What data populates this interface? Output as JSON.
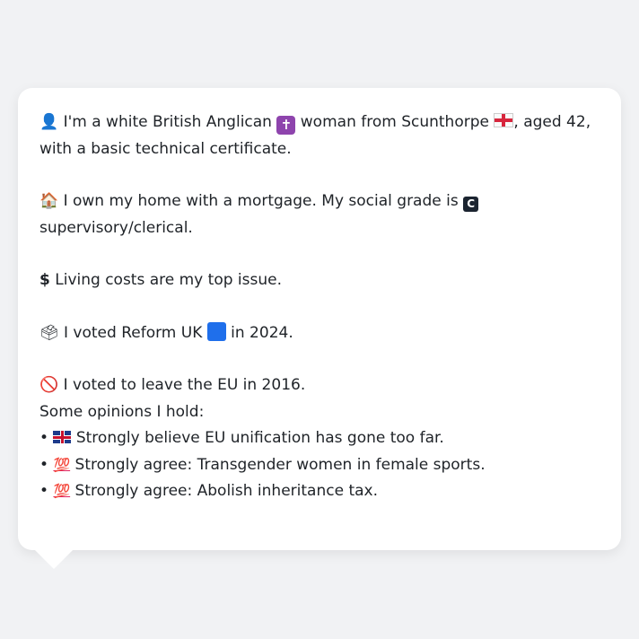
{
  "profile": {
    "intro": {
      "icon": "person-silhouette-icon",
      "text_a": "I'm a white British Anglican",
      "icon_religion": "latin-cross-icon",
      "text_b": "woman from Scunthorpe",
      "icon_flag": "england-flag-icon",
      "text_c": ", aged 42, with a basic technical certificate."
    },
    "home": {
      "icon": "house-icon",
      "text_a": "I own my home with a mortgage. My social grade is",
      "grade_letter": "C",
      "text_b": "supervisory/clerical."
    },
    "issue": {
      "icon": "dollar-sign-icon",
      "text": "Living costs are my top issue."
    },
    "vote2024": {
      "icon": "ballot-box-icon",
      "text_a": "I voted Reform UK",
      "party_color_icon": "blue-square-icon",
      "text_b": "in 2024."
    },
    "vote2016": {
      "icon": "no-entry-icon",
      "text": "I voted to leave the EU in 2016."
    },
    "opinions": {
      "heading": "Some opinions I hold:",
      "items": [
        {
          "bullet": "•",
          "icon": "uk-flag-icon",
          "text": "Strongly believe EU unification has gone too far."
        },
        {
          "bullet": "•",
          "icon": "hundred-points-icon",
          "text": "Strongly agree: Transgender women in female sports."
        },
        {
          "bullet": "•",
          "icon": "hundred-points-icon",
          "text": "Strongly agree: Abolish inheritance tax."
        }
      ]
    }
  },
  "colors": {
    "background": "#f1f2f4",
    "bubble": "#ffffff",
    "text": "#1f2328",
    "party_blue": "#1f6feb"
  }
}
